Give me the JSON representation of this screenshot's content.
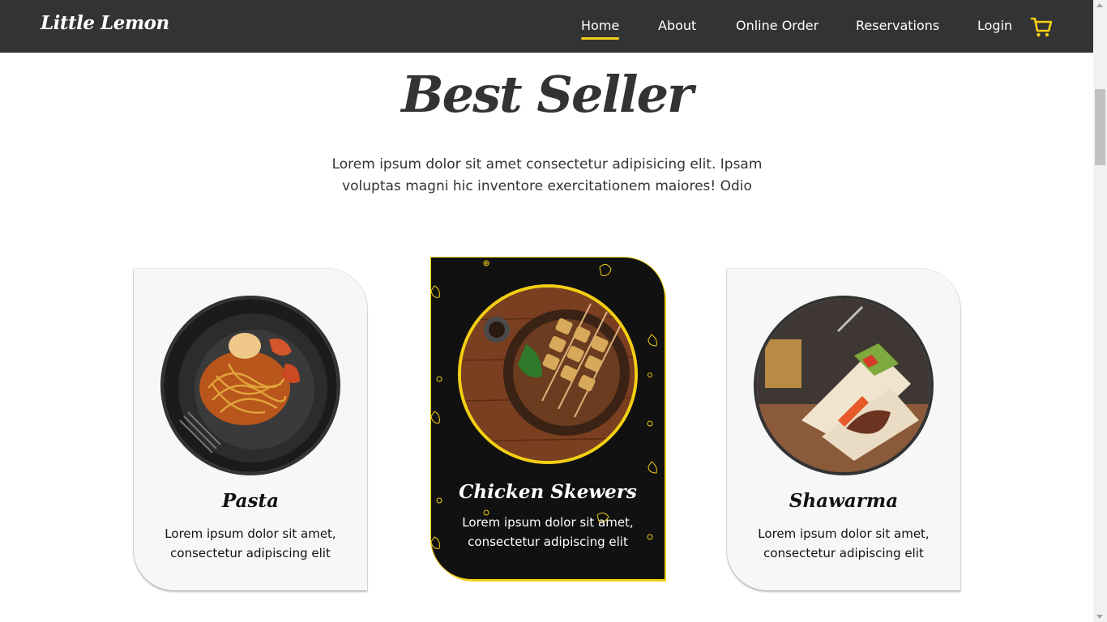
{
  "nav": {
    "logo": "Little Lemon",
    "links": [
      {
        "label": "Home",
        "active": true
      },
      {
        "label": "About",
        "active": false
      },
      {
        "label": "Online Order",
        "active": false
      },
      {
        "label": "Reservations",
        "active": false
      },
      {
        "label": "Login",
        "active": false
      }
    ],
    "cart_icon": "shopping-cart-icon"
  },
  "section": {
    "title": "Best Seller",
    "description": "Lorem ipsum dolor sit amet consectetur adipisicing elit. Ipsam voluptas magni hic inventore exercitationem maiores! Odio"
  },
  "cards": [
    {
      "title": "Pasta",
      "description": "Lorem ipsum dolor sit amet, consectetur adipiscing elit",
      "featured": false,
      "image": "pasta-dish-photo"
    },
    {
      "title": "Chicken Skewers",
      "description": "Lorem ipsum dolor sit amet, consectetur adipiscing elit",
      "featured": true,
      "image": "chicken-skewers-photo"
    },
    {
      "title": "Shawarma",
      "description": "Lorem ipsum dolor sit amet, consectetur adipiscing elit",
      "featured": false,
      "image": "shawarma-wrap-photo"
    }
  ],
  "colors": {
    "nav_bg": "#333333",
    "accent": "#F4CE14",
    "card_bg": "#F7F7F7",
    "featured_card_bg": "#111111",
    "text": "#333333"
  }
}
